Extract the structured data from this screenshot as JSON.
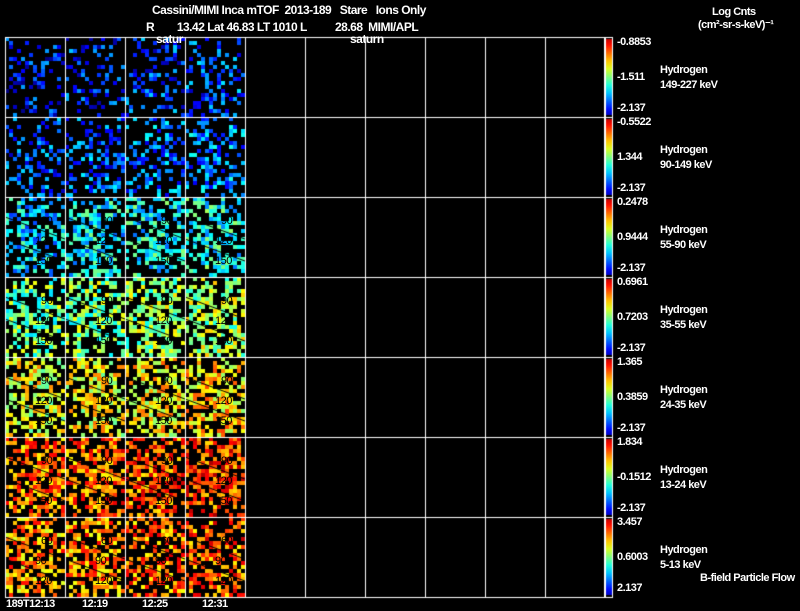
{
  "header": {
    "title": "Cassini/MIMI Inca mTOF  2013-189   Stare   Ions Only",
    "subtitle": "R        13.42 Lat 46.83 LT 1010 L          28.68  MIMI/APL",
    "planet_label_1": "satur",
    "planet_label_2": "saturn"
  },
  "units": {
    "line1": "Log Cnts",
    "line2": "(cm²-sr-s-keV)⁻¹"
  },
  "footer_note": "B-field Particle Flow",
  "time_labels": [
    "189T12:13",
    "12:19",
    "12:25",
    "12:31"
  ],
  "colors": {
    "background": "#000000",
    "grid": "#ffffff",
    "text": "#ffffff"
  },
  "chart_data": {
    "type": "heatmap",
    "grid": {
      "rows": 7,
      "columns": 10,
      "filled_columns": 4
    },
    "rows": [
      {
        "species": "Hydrogen",
        "energy": "149-227 keV",
        "max": "-0.8853",
        "mid": "-1.511",
        "min": "-2.137",
        "level": 0.15,
        "fill": 0.35,
        "contours": []
      },
      {
        "species": "Hydrogen",
        "energy": "90-149 keV",
        "max": "-0.5522",
        "mid": "1.344",
        "min": "-2.137",
        "level": 0.2,
        "fill": 0.45,
        "contours": []
      },
      {
        "species": "Hydrogen",
        "energy": "55-90 keV",
        "max": "0.2478",
        "mid": "0.9444",
        "min": "-2.137",
        "level": 0.33,
        "fill": 0.6,
        "contours": [
          "90",
          "120",
          "150"
        ]
      },
      {
        "species": "Hydrogen",
        "energy": "35-55 keV",
        "max": "0.6961",
        "mid": "0.7203",
        "min": "-2.137",
        "level": 0.48,
        "fill": 0.7,
        "contours": [
          "90",
          "120",
          "150"
        ]
      },
      {
        "species": "Hydrogen",
        "energy": "24-35 keV",
        "max": "1.365",
        "mid": "0.3859",
        "min": "-2.137",
        "level": 0.6,
        "fill": 0.7,
        "contours": [
          "90",
          "120",
          "150"
        ]
      },
      {
        "species": "Hydrogen",
        "energy": "13-24 keV",
        "max": "1.834",
        "mid": "-0.1512",
        "min": "-2.137",
        "level": 0.75,
        "fill": 0.75,
        "contours": [
          "90",
          "120",
          "150"
        ]
      },
      {
        "species": "Hydrogen",
        "energy": "5-13 keV",
        "max": "3.457",
        "mid": "0.6003",
        "min": "2.137",
        "level": 0.72,
        "fill": 0.65,
        "contours": [
          "60",
          "90",
          "120"
        ]
      }
    ]
  }
}
